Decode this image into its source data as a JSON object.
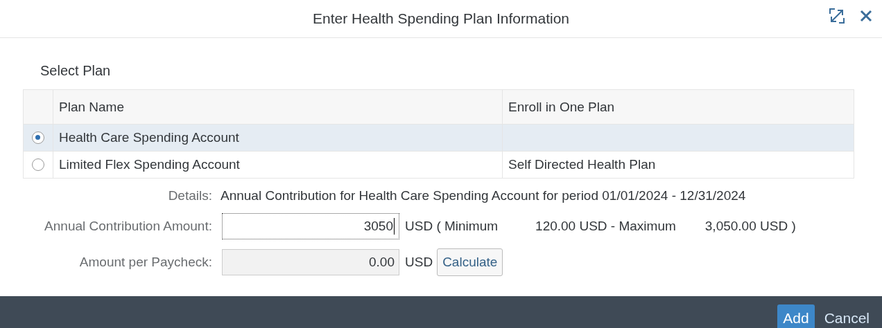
{
  "dialog": {
    "title": "Enter Health Spending Plan Information"
  },
  "section": {
    "title": "Select Plan"
  },
  "table": {
    "columns": [
      "Plan Name",
      "Enroll in One Plan"
    ],
    "rows": [
      {
        "selected": true,
        "cells": [
          "Health Care Spending Account",
          ""
        ]
      },
      {
        "selected": false,
        "cells": [
          "Limited Flex Spending Account",
          "Self Directed Health Plan"
        ]
      }
    ]
  },
  "details": {
    "label": "Details:",
    "text": "Annual Contribution for Health Care Spending Account for period 01/01/2024 - 12/31/2024"
  },
  "annual": {
    "label": "Annual Contribution Amount:",
    "value": "3050",
    "unit": "USD ( Minimum",
    "min": "120.00 USD - Maximum",
    "max": "3,050.00 USD )"
  },
  "paycheck": {
    "label": "Amount per Paycheck:",
    "value": "0.00",
    "unit": "USD",
    "button": "Calculate"
  },
  "footer": {
    "buttons": [
      {
        "label": "Add",
        "kind": "primary"
      },
      {
        "label": "Cancel",
        "kind": "plain"
      }
    ]
  }
}
